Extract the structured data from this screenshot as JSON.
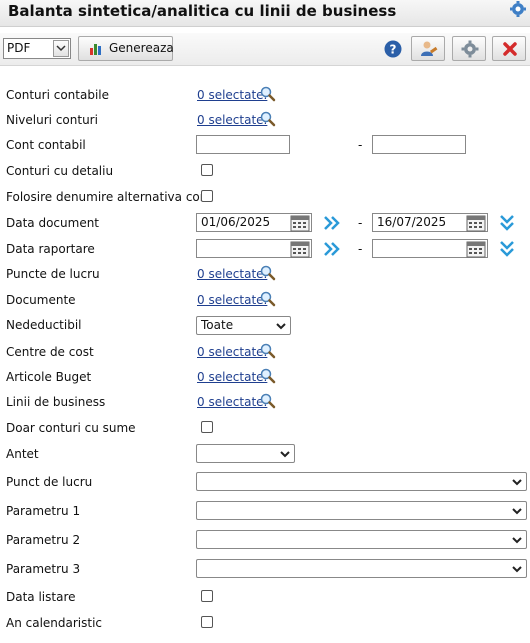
{
  "title": "Balanta sintetica/analitica cu linii de business",
  "toolbar": {
    "format_value": "PDF",
    "generate_label": "Genereaza"
  },
  "fields": {
    "conturi_contabile": {
      "label": "Conturi contabile",
      "link": "0 selectate."
    },
    "niveluri_conturi": {
      "label": "Niveluri conturi",
      "link": "0 selectate."
    },
    "cont_contabil": {
      "label": "Cont contabil",
      "from": "",
      "to": ""
    },
    "conturi_cu_detaliu": {
      "label": "Conturi cu detaliu"
    },
    "denumire_alternativa": {
      "label": "Folosire denumire alternativa cont"
    },
    "data_document": {
      "label": "Data document",
      "from": "01/06/2025",
      "to": "16/07/2025"
    },
    "data_raportare": {
      "label": "Data raportare",
      "from": "",
      "to": ""
    },
    "puncte_de_lucru": {
      "label": "Puncte de lucru",
      "link": "0 selectate."
    },
    "documente": {
      "label": "Documente",
      "link": "0 selectate."
    },
    "nedeductibil": {
      "label": "Nedeductibil",
      "value": "Toate"
    },
    "centre_de_cost": {
      "label": "Centre de cost",
      "link": "0 selectate."
    },
    "articole_buget": {
      "label": "Articole Buget",
      "link": "0 selectate."
    },
    "linii_de_business": {
      "label": "Linii de business",
      "link": "0 selectate."
    },
    "doar_conturi_cu_sume": {
      "label": "Doar conturi cu sume"
    },
    "antet": {
      "label": "Antet",
      "value": ""
    },
    "punct_de_lucru": {
      "label": "Punct de lucru",
      "value": ""
    },
    "parametru_1": {
      "label": "Parametru 1",
      "value": ""
    },
    "parametru_2": {
      "label": "Parametru 2",
      "value": ""
    },
    "parametru_3": {
      "label": "Parametru 3",
      "value": ""
    },
    "data_listare": {
      "label": "Data listare"
    },
    "an_calendaristic": {
      "label": "An calendaristic"
    }
  },
  "range_separator": "-",
  "colors": {
    "link": "#1f3f8f",
    "arrow_blue": "#2a9ad8",
    "delete_red": "#d42b2b"
  }
}
